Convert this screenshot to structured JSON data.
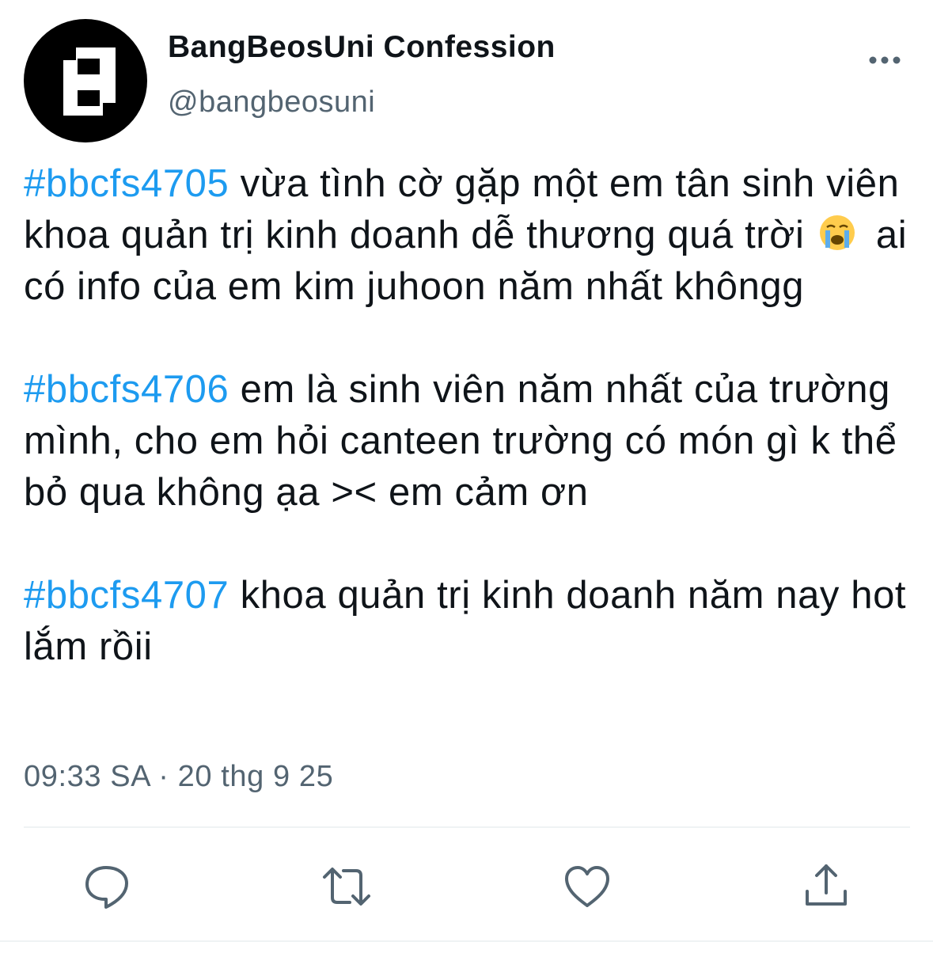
{
  "account": {
    "display_name": "BangBeosUni Confession",
    "handle": "@bangbeosuni",
    "avatar_icon": "block-letter-logo"
  },
  "header": {
    "more_icon": "ellipsis-icon"
  },
  "tweet": {
    "paragraphs": [
      {
        "hashtag": "#bbcfs4705",
        "text_before_emoji": " vừa tình cờ gặp một em tân sinh viên khoa quản trị kinh doanh dễ thương quá trời ",
        "emoji": "loudly-crying-face",
        "text_after_emoji": " ai có info của em kim juhoon năm nhất khôngg"
      },
      {
        "hashtag": "#bbcfs4706",
        "text": " em là sinh viên năm nhất của trường mình, cho em hỏi canteen trường có món gì k thể bỏ qua không ạa >< em cảm ơn"
      },
      {
        "hashtag": "#bbcfs4707",
        "text": " khoa quản trị kinh doanh năm nay hot lắm rồii"
      }
    ],
    "timestamp": "09:33 SA · 20 thg 9 25"
  },
  "actions": [
    {
      "name": "reply",
      "icon": "speech-bubble-icon"
    },
    {
      "name": "retweet",
      "icon": "retweet-arrows-icon"
    },
    {
      "name": "like",
      "icon": "heart-icon"
    },
    {
      "name": "share",
      "icon": "share-upload-icon"
    }
  ],
  "colors": {
    "hashtag": "#1d9bf0",
    "secondary_text": "#536471",
    "primary_text": "#0f1419",
    "divider": "#eff3f4"
  }
}
